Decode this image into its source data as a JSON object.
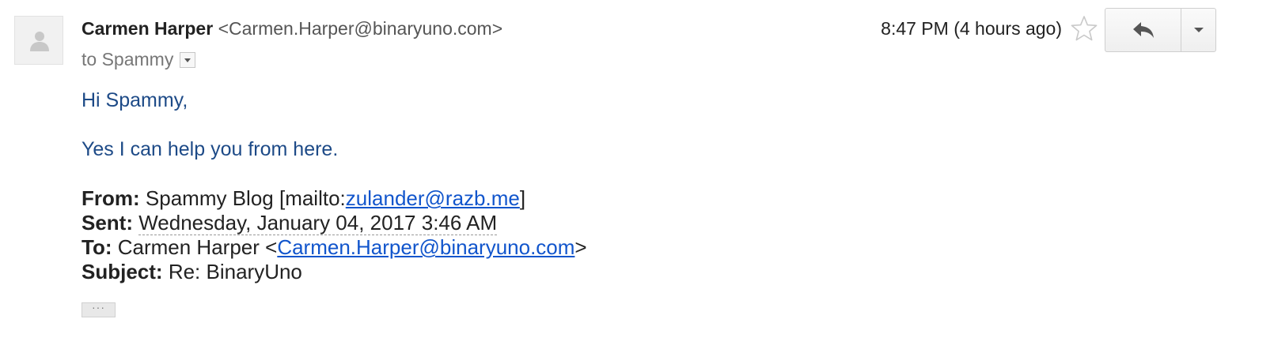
{
  "sender": {
    "name": "Carmen Harper",
    "address": "<Carmen.Harper@binaryuno.com>",
    "to_line": "to Spammy"
  },
  "header": {
    "time": "8:47 PM (4 hours ago)"
  },
  "body": {
    "greeting": "Hi Spammy,",
    "message": "Yes I can help you from here."
  },
  "quoted": {
    "from_label": "From:",
    "from_text": "Spammy Blog [mailto:",
    "from_link": "zulander@razb.me",
    "from_tail": "]",
    "sent_label": "Sent:",
    "sent_value": "Wednesday, January 04, 2017 3:46 AM",
    "to_label": "To:",
    "to_text": "Carmen Harper <",
    "to_link": "Carmen.Harper@binaryuno.com",
    "to_tail": ">",
    "subject_label": "Subject:",
    "subject_value": "Re: BinaryUno"
  },
  "show_trimmed": "···",
  "icons": {
    "avatar": "person-icon",
    "star": "star-icon",
    "reply": "reply-icon",
    "more": "chevron-down-icon",
    "recipients": "details-dropdown-icon"
  },
  "colors": {
    "body_text": "#1d4a87",
    "link": "#1155cc"
  }
}
